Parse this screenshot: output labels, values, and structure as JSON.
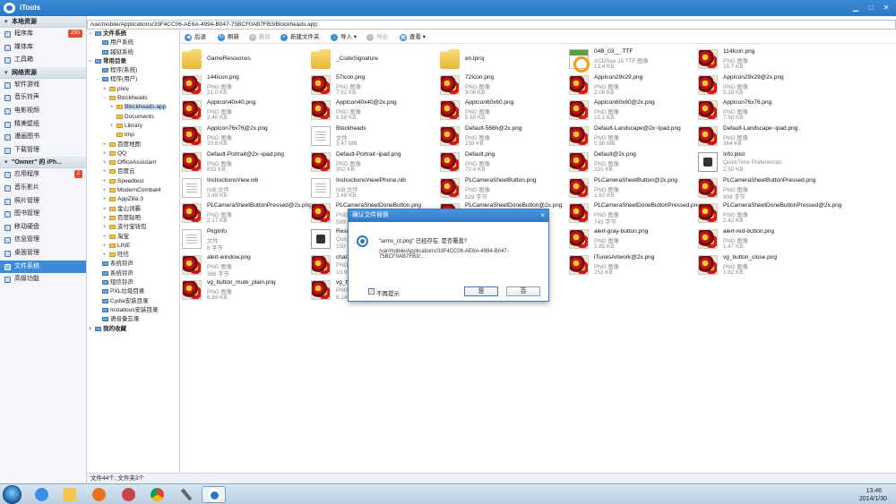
{
  "app": {
    "title": "iTools",
    "logo": "itools-logo-icon"
  },
  "window_controls": [
    "minimize",
    "maximize",
    "close"
  ],
  "left_nav": {
    "sections": [
      {
        "title": "本地资源",
        "items": [
          {
            "label": "程序库",
            "badge": "230",
            "icon": "apps-icon"
          },
          {
            "label": "媒体库",
            "icon": "media-icon"
          },
          {
            "label": "工具箱",
            "icon": "toolbox-icon"
          }
        ]
      },
      {
        "title": "网络资源",
        "items": [
          {
            "label": "软件游戏",
            "icon": "games-icon"
          },
          {
            "label": "音乐铃声",
            "icon": "music-icon"
          },
          {
            "label": "电影视频",
            "icon": "video-icon"
          },
          {
            "label": "精美壁纸",
            "icon": "wallpaper-icon"
          },
          {
            "label": "漫画图书",
            "icon": "book-icon"
          },
          {
            "label": "下载管理",
            "icon": "download-icon"
          }
        ]
      },
      {
        "title": "\"Owner\" 的 iPh...",
        "items": [
          {
            "label": "应用程序",
            "badge": "2",
            "icon": "apps-icon"
          },
          {
            "label": "音乐影片",
            "icon": "music-icon"
          },
          {
            "label": "照片管理",
            "icon": "photo-icon"
          },
          {
            "label": "图书管理",
            "icon": "book-icon"
          },
          {
            "label": "移动硬盘",
            "icon": "disk-icon"
          },
          {
            "label": "信息管理",
            "icon": "message-icon"
          },
          {
            "label": "桌面管理",
            "icon": "desktop-icon"
          },
          {
            "label": "文件系统",
            "icon": "folder-icon",
            "selected": true
          },
          {
            "label": "高级功能",
            "icon": "advanced-icon"
          }
        ]
      }
    ]
  },
  "path": "/var/mobile/Applications/33F4CC06-AE6A-4994-B047-75BCF0AB7FB3/Blockheads.app",
  "toolbar": {
    "back": "后退",
    "refresh": "刷新",
    "delete": "删除",
    "new_folder": "新建文件夹",
    "import": "导入",
    "export": "导出",
    "view": "查看"
  },
  "tree": [
    {
      "label": "文件系统",
      "indent": 0,
      "exp": "−",
      "bold": true
    },
    {
      "label": "用户系统",
      "indent": 1,
      "exp": ""
    },
    {
      "label": "越狱系统",
      "indent": 1,
      "exp": ""
    },
    {
      "label": "常用目录",
      "indent": 0,
      "exp": "−",
      "bold": true
    },
    {
      "label": "程序(系统)",
      "indent": 1,
      "exp": ""
    },
    {
      "label": "程序(用户)",
      "indent": 1,
      "exp": "−"
    },
    {
      "label": "pixiv",
      "indent": 2,
      "exp": "+"
    },
    {
      "label": "Blockheads",
      "indent": 2,
      "exp": "−"
    },
    {
      "label": "Blockheads.app",
      "indent": 3,
      "exp": "+",
      "selected": true
    },
    {
      "label": "Documents",
      "indent": 3,
      "exp": ""
    },
    {
      "label": "Library",
      "indent": 3,
      "exp": "+"
    },
    {
      "label": "tmp",
      "indent": 3,
      "exp": ""
    },
    {
      "label": "百度地图",
      "indent": 2,
      "exp": "+"
    },
    {
      "label": "QQ",
      "indent": 2,
      "exp": "+"
    },
    {
      "label": "OfficeAssistant",
      "indent": 2,
      "exp": "+"
    },
    {
      "label": "百度云",
      "indent": 2,
      "exp": "+"
    },
    {
      "label": "Speedtest",
      "indent": 2,
      "exp": "+"
    },
    {
      "label": "ModernCombat4",
      "indent": 2,
      "exp": "+"
    },
    {
      "label": "AppZilla 3",
      "indent": 2,
      "exp": "+"
    },
    {
      "label": "金山词霸",
      "indent": 2,
      "exp": "+"
    },
    {
      "label": "百度贴吧",
      "indent": 2,
      "exp": "+"
    },
    {
      "label": "支付宝钱包",
      "indent": 2,
      "exp": "+"
    },
    {
      "label": "淘宝",
      "indent": 2,
      "exp": "+"
    },
    {
      "label": "LINE",
      "indent": 2,
      "exp": "+"
    },
    {
      "label": "旺信",
      "indent": 2,
      "exp": "+"
    },
    {
      "label": "系统铃声",
      "indent": 1,
      "exp": ""
    },
    {
      "label": "系统铃声",
      "indent": 1,
      "exp": ""
    },
    {
      "label": "短信铃声",
      "indent": 1,
      "exp": ""
    },
    {
      "label": "PXL垃圾目录",
      "indent": 1,
      "exp": ""
    },
    {
      "label": "Cydia安装目录",
      "indent": 1,
      "exp": ""
    },
    {
      "label": "Installous安装目录",
      "indent": 1,
      "exp": ""
    },
    {
      "label": "语音备忘录",
      "indent": 1,
      "exp": ""
    },
    {
      "label": "我的收藏",
      "indent": 0,
      "exp": "+",
      "bold": true
    }
  ],
  "files": [
    {
      "name": "GameResources",
      "type": "",
      "size": "",
      "icon": "folder"
    },
    {
      "name": "_CodeSignature",
      "type": "",
      "size": "",
      "icon": "folder"
    },
    {
      "name": "en.lproj",
      "type": "",
      "size": "",
      "icon": "folder"
    },
    {
      "name": "04B_03__.TTF",
      "type": "ACDSee 15 TTF 图像",
      "size": "13.4 KB",
      "icon": "ttf"
    },
    {
      "name": "114Icon.png",
      "type": "PNG 图像",
      "size": "15.7 KB",
      "icon": "img"
    },
    {
      "name": "144Icon.png",
      "type": "PNG 图像",
      "size": "21.0 KB",
      "icon": "img"
    },
    {
      "name": "57Icon.png",
      "type": "PNG 图像",
      "size": "7.52 KB",
      "icon": "img"
    },
    {
      "name": "72Icon.png",
      "type": "PNG 图像",
      "size": "9.06 KB",
      "icon": "img"
    },
    {
      "name": "AppIcon29x29.png",
      "type": "PNG 图像",
      "size": "2.06 KB",
      "icon": "img"
    },
    {
      "name": "AppIcon29x29@2x.png",
      "type": "PNG 图像",
      "size": "5.18 KB",
      "icon": "img"
    },
    {
      "name": "AppIcon40x40.png",
      "type": "PNG 图像",
      "size": "2.40 KB",
      "icon": "img"
    },
    {
      "name": "AppIcon40x40@2x.png",
      "type": "PNG 图像",
      "size": "6.58 KB",
      "icon": "img"
    },
    {
      "name": "AppIcon60x60.png",
      "type": "PNG 图像",
      "size": "5.50 KB",
      "icon": "img"
    },
    {
      "name": "AppIcon60x60@2x.png",
      "type": "PNG 图像",
      "size": "15.1 KB",
      "icon": "img"
    },
    {
      "name": "AppIcon76x76.png",
      "type": "PNG 图像",
      "size": "7.50 KB",
      "icon": "img"
    },
    {
      "name": "AppIcon76x76@2x.png",
      "type": "PNG 图像",
      "size": "20.8 KB",
      "icon": "img"
    },
    {
      "name": "Blockheads",
      "type": "文件",
      "size": "3.47 MB",
      "icon": "doc"
    },
    {
      "name": "Default-568h@2x.png",
      "type": "PNG 图像",
      "size": "239 KB",
      "icon": "img"
    },
    {
      "name": "Default-Landscape@2x~ipad.png",
      "type": "PNG 图像",
      "size": "0.98 MB",
      "icon": "img"
    },
    {
      "name": "Default-Landscape~ipad.png",
      "type": "PNG 图像",
      "size": "364 KB",
      "icon": "img"
    },
    {
      "name": "Default-Portrait@2x~ipad.png",
      "type": "PNG 图像",
      "size": "833 KB",
      "icon": "img"
    },
    {
      "name": "Default-Portrait~ipad.png",
      "type": "PNG 图像",
      "size": "302 KB",
      "icon": "img"
    },
    {
      "name": "Default.png",
      "type": "PNG 图像",
      "size": "72.4 KB",
      "icon": "img"
    },
    {
      "name": "Default@2x.png",
      "type": "PNG 图像",
      "size": "215 KB",
      "icon": "img"
    },
    {
      "name": "Info.plist",
      "type": "QuickTime Preferences",
      "size": "2.50 KB",
      "icon": "plist"
    },
    {
      "name": "InstructionsView.nib",
      "type": "NIB 文件",
      "size": "2.48 KB",
      "icon": "doc"
    },
    {
      "name": "InstructionsViewiPhone.nib",
      "type": "NIB 文件",
      "size": "2.48 KB",
      "icon": "doc"
    },
    {
      "name": "PLCameraSheetButton.png",
      "type": "PNG 图像",
      "size": "629 字节",
      "icon": "img"
    },
    {
      "name": "PLCameraSheetButton@2x.png",
      "type": "PNG 图像",
      "size": "1.62 KB",
      "icon": "img"
    },
    {
      "name": "PLCameraSheetButtonPressed.png",
      "type": "PNG 图像",
      "size": "908 字节",
      "icon": "img"
    },
    {
      "name": "PLCameraSheetButtonPressed@2x.png",
      "type": "PNG 图像",
      "size": "2.17 KB",
      "icon": "img"
    },
    {
      "name": "PLCameraSheetDoneButton.png",
      "type": "PNG 图像",
      "size": "599 字节",
      "icon": "img"
    },
    {
      "name": "PLCameraSheetDoneButton@2x.png",
      "type": "PNG 图像",
      "size": "1.64 KB",
      "icon": "img"
    },
    {
      "name": "PLCameraSheetDoneButtonPressed.png",
      "type": "PNG 图像",
      "size": "743 字节",
      "icon": "img"
    },
    {
      "name": "PLCameraSheetDoneButtonPressed@2x.png",
      "type": "PNG 图像",
      "size": "2.42 KB",
      "icon": "img"
    },
    {
      "name": "PkgInfo",
      "type": "文件",
      "size": "8 字节",
      "icon": "doc"
    },
    {
      "name": "Resc...",
      "type": "Quic...",
      "size": "150 ...",
      "icon": "plist"
    },
    {
      "name": "",
      "type": "",
      "size": "",
      "icon": ""
    },
    {
      "name": "alert-gray-button.png",
      "type": "PNG 图像",
      "size": "2.85 KB",
      "icon": "img"
    },
    {
      "name": "alert-red-button.png",
      "type": "PNG 图像",
      "size": "1.47 KB",
      "icon": "img"
    },
    {
      "name": "alert-window.png",
      "type": "PNG 图像",
      "size": "386 字节",
      "icon": "img"
    },
    {
      "name": "chat...",
      "type": "PNG ...",
      "size": "10.9 ...",
      "icon": "img"
    },
    {
      "name": "",
      "type": "",
      "size": "",
      "icon": ""
    },
    {
      "name": "iTunesArtwork@2x.png",
      "type": "PNG 图像",
      "size": "253 KB",
      "icon": "img"
    },
    {
      "name": "vg_button_close.png",
      "type": "PNG 图像",
      "size": "1.82 KB",
      "icon": "img"
    },
    {
      "name": "vg_button_mute_plain.png",
      "type": "PNG 图像",
      "size": "6.84 KB",
      "icon": "img"
    },
    {
      "name": "vg_b...",
      "type": "PNG ...",
      "size": "8.14 ...",
      "icon": "img"
    }
  ],
  "status": "文件44个, 文件夹3个",
  "dialog": {
    "title": "确认文件替换",
    "message": "\"arms_ct.png\" 已经存在, 是否覆盖?",
    "path": "/var/mobile/Applications/33F4CC06-AE6A-4994-B047-75BCF0AB7FB3/...",
    "checkbox_label": "不再提示",
    "checkbox_checked": true,
    "yes": "是",
    "no": "否"
  },
  "taskbar": {
    "apps": [
      "ie-icon",
      "explorer-icon",
      "firefox-icon",
      "paint-icon",
      "chrome-icon",
      "tool-icon",
      "itools-icon"
    ],
    "time": "13:46",
    "date": "2014/1/30"
  },
  "colors": {
    "accent": "#2c77c4",
    "selection": "#3b8bd9",
    "badge": "#e64b2c"
  }
}
